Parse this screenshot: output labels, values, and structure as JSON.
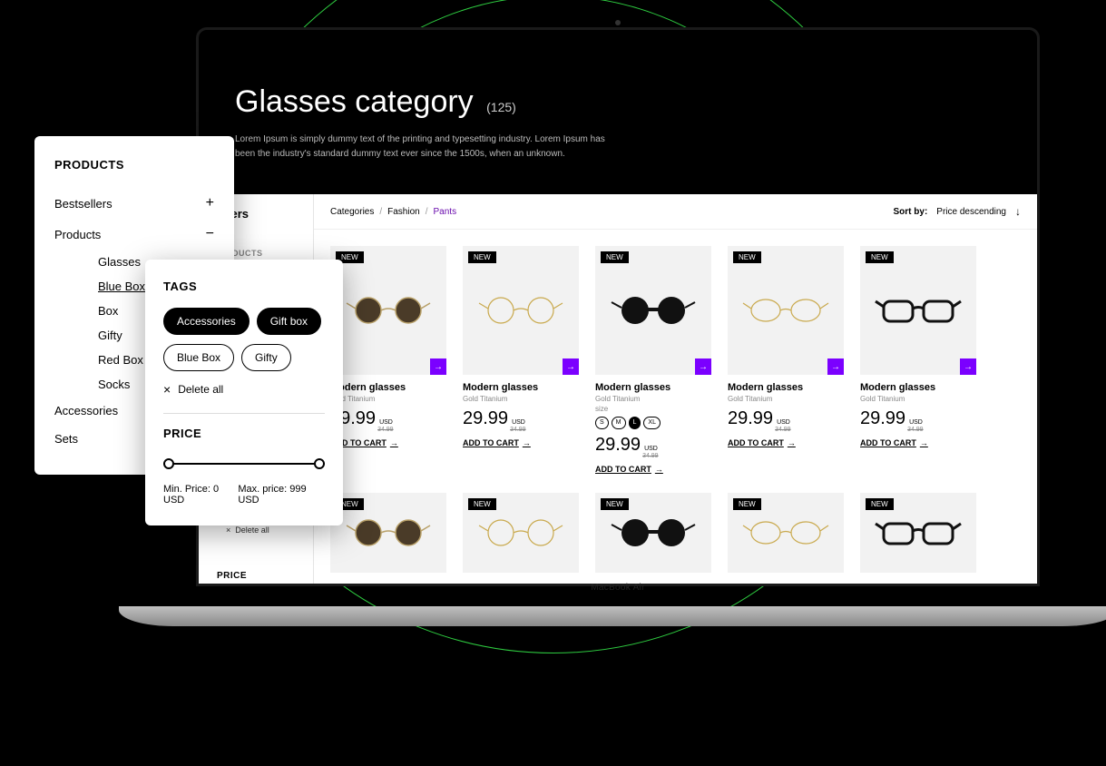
{
  "laptop_label": "MacBook Air",
  "hero": {
    "title": "Glasses category",
    "count": "(125)",
    "description": "Lorem Ipsum is simply dummy text of the printing and typesetting industry. Lorem Ipsum has been the industry's standard dummy text ever since the 1500s, when an unknown."
  },
  "filters": {
    "title": "Filters",
    "hidden_label": "PRODUCTS",
    "delete_all": "Delete all",
    "price_label": "PRICE"
  },
  "breadcrumb": {
    "items": [
      "Categories",
      "Fashion",
      "Pants"
    ]
  },
  "sort": {
    "label": "Sort by:",
    "value": "Price descending"
  },
  "product": {
    "badge": "NEW",
    "title": "Modern glasses",
    "subtitle": "Gold Titanium",
    "size_label": "size",
    "sizes": [
      "S",
      "M",
      "L",
      "XL"
    ],
    "price": "29.99",
    "currency": "USD",
    "compare": "34.99",
    "add": "ADD TO CART"
  },
  "products_panel": {
    "heading": "PRODUCTS",
    "categories": [
      {
        "label": "Bestsellers",
        "expanded": false
      },
      {
        "label": "Products",
        "expanded": true
      },
      {
        "label": "Accessories",
        "expanded": null
      },
      {
        "label": "Sets",
        "expanded": null
      }
    ],
    "subcategories": [
      "Glasses",
      "Blue Box",
      "Box",
      "Gifty",
      "Red Box",
      "Socks"
    ]
  },
  "tags_panel": {
    "heading": "TAGS",
    "tags": [
      {
        "label": "Accessories",
        "active": true
      },
      {
        "label": "Gift box",
        "active": true
      },
      {
        "label": "Blue Box",
        "active": false
      },
      {
        "label": "Gifty",
        "active": false
      }
    ],
    "delete_all": "Delete all",
    "price_heading": "PRICE",
    "min_label": "Min. Price: 0 USD",
    "max_label": "Max. price: 999 USD"
  }
}
